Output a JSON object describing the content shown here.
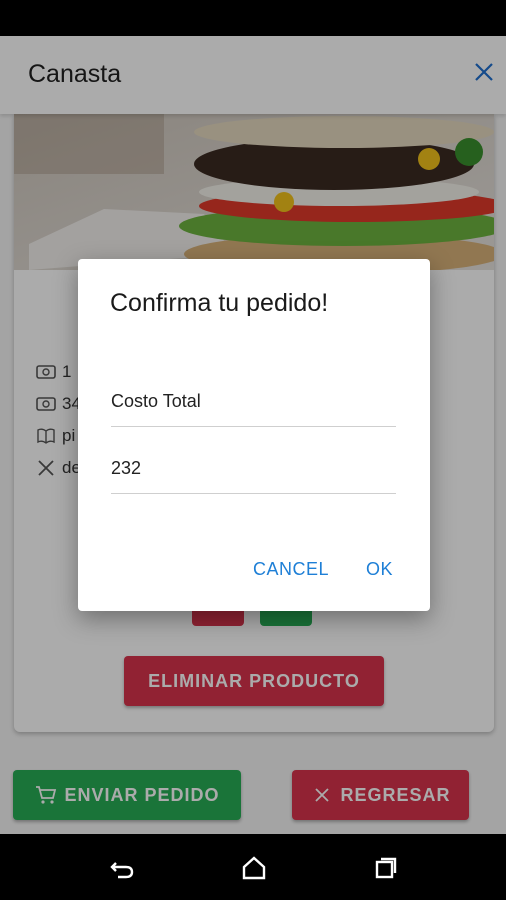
{
  "appbar": {
    "title": "Canasta",
    "close_icon": "close-icon"
  },
  "card": {
    "image": "burger-photo",
    "info_rows": [
      {
        "icon": "money-icon",
        "text": "1"
      },
      {
        "icon": "money-icon",
        "text": "34"
      },
      {
        "icon": "book-icon",
        "text": "pi"
      },
      {
        "icon": "utensils-icon",
        "text": "de"
      }
    ],
    "eliminar_label": "ELIMINAR PRODUCTO"
  },
  "footer": {
    "enviar_label": "ENVIAR PEDIDO",
    "regresar_label": "REGRESAR"
  },
  "dialog": {
    "title": "Confirma tu pedido!",
    "field_label": "Costo Total",
    "field_value": "232",
    "cancel_label": "CANCEL",
    "ok_label": "OK"
  },
  "colors": {
    "red": "#d9334c",
    "green": "#27ae55",
    "accent": "#1e7fd6"
  }
}
